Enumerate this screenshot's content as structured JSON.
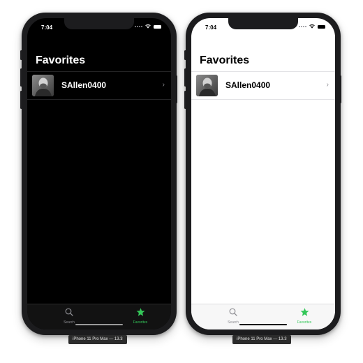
{
  "devices": [
    {
      "theme": "dark",
      "label": "iPhone 11 Pro Max — 13.3",
      "status_bar": {
        "time": "7:04"
      },
      "navigation": {
        "title": "Favorites"
      },
      "favorites": [
        {
          "username": "SAllen0400"
        }
      ],
      "tab_bar": {
        "items": [
          {
            "label": "Search",
            "icon": "search-icon",
            "selected": false
          },
          {
            "label": "Favorites",
            "icon": "star-icon",
            "selected": true
          }
        ]
      }
    },
    {
      "theme": "light",
      "label": "iPhone 11 Pro Max — 13.3",
      "status_bar": {
        "time": "7:04"
      },
      "navigation": {
        "title": "Favorites"
      },
      "favorites": [
        {
          "username": "SAllen0400"
        }
      ],
      "tab_bar": {
        "items": [
          {
            "label": "Search",
            "icon": "search-icon",
            "selected": false
          },
          {
            "label": "Favorites",
            "icon": "star-icon",
            "selected": true
          }
        ]
      }
    }
  ],
  "colors": {
    "accent_selected": "#34c759",
    "tab_unselected": "#8e8e93",
    "dark_background": "#000000",
    "light_background": "#ffffff"
  }
}
